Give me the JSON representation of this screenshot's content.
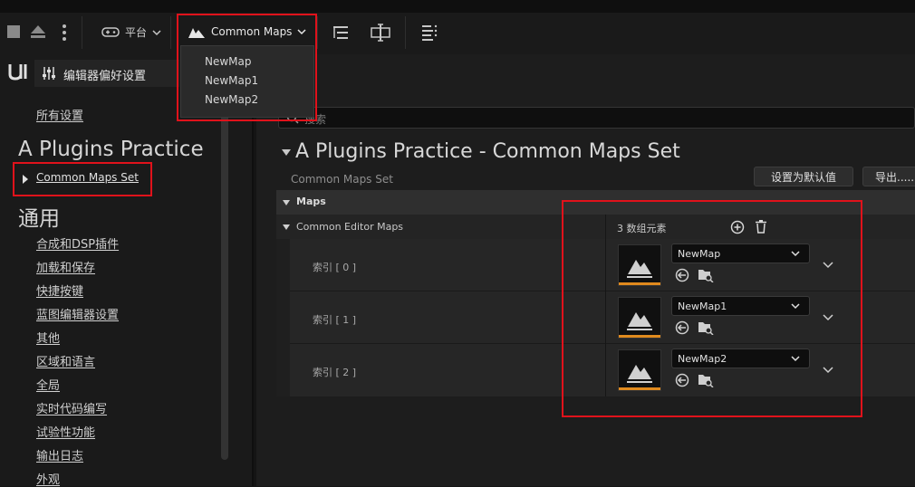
{
  "toolbar": {
    "platform_label": "平台",
    "map_selector_label": "Common Maps",
    "map_options": [
      "NewMap",
      "NewMap1",
      "NewMap2"
    ]
  },
  "sidebar": {
    "header_title": "编辑器偏好设置",
    "all_settings": "所有设置",
    "section1_title": "A Plugins Practice",
    "section1_items": [
      "Common Maps Set"
    ],
    "section2_title": "通用",
    "section2_items": [
      "合成和DSP插件",
      "加载和保存",
      "快捷按键",
      "蓝图编辑器设置",
      "其他",
      "区域和语言",
      "全局",
      "实时代码编写",
      "试验性功能",
      "输出日志",
      "外观"
    ]
  },
  "main": {
    "search_placeholder": "搜索",
    "title": "A Plugins Practice - Common Maps Set",
    "subtitle": "Common Maps Set",
    "set_default_button": "设置为默认值",
    "export_button": "导出......",
    "category": "Maps",
    "property_name": "Common Editor Maps",
    "array_count": "3 数组元素",
    "elements": [
      {
        "index_label": "索引 [ 0 ]",
        "value": "NewMap"
      },
      {
        "index_label": "索引 [ 1 ]",
        "value": "NewMap1"
      },
      {
        "index_label": "索引 [ 2 ]",
        "value": "NewMap2"
      }
    ]
  }
}
